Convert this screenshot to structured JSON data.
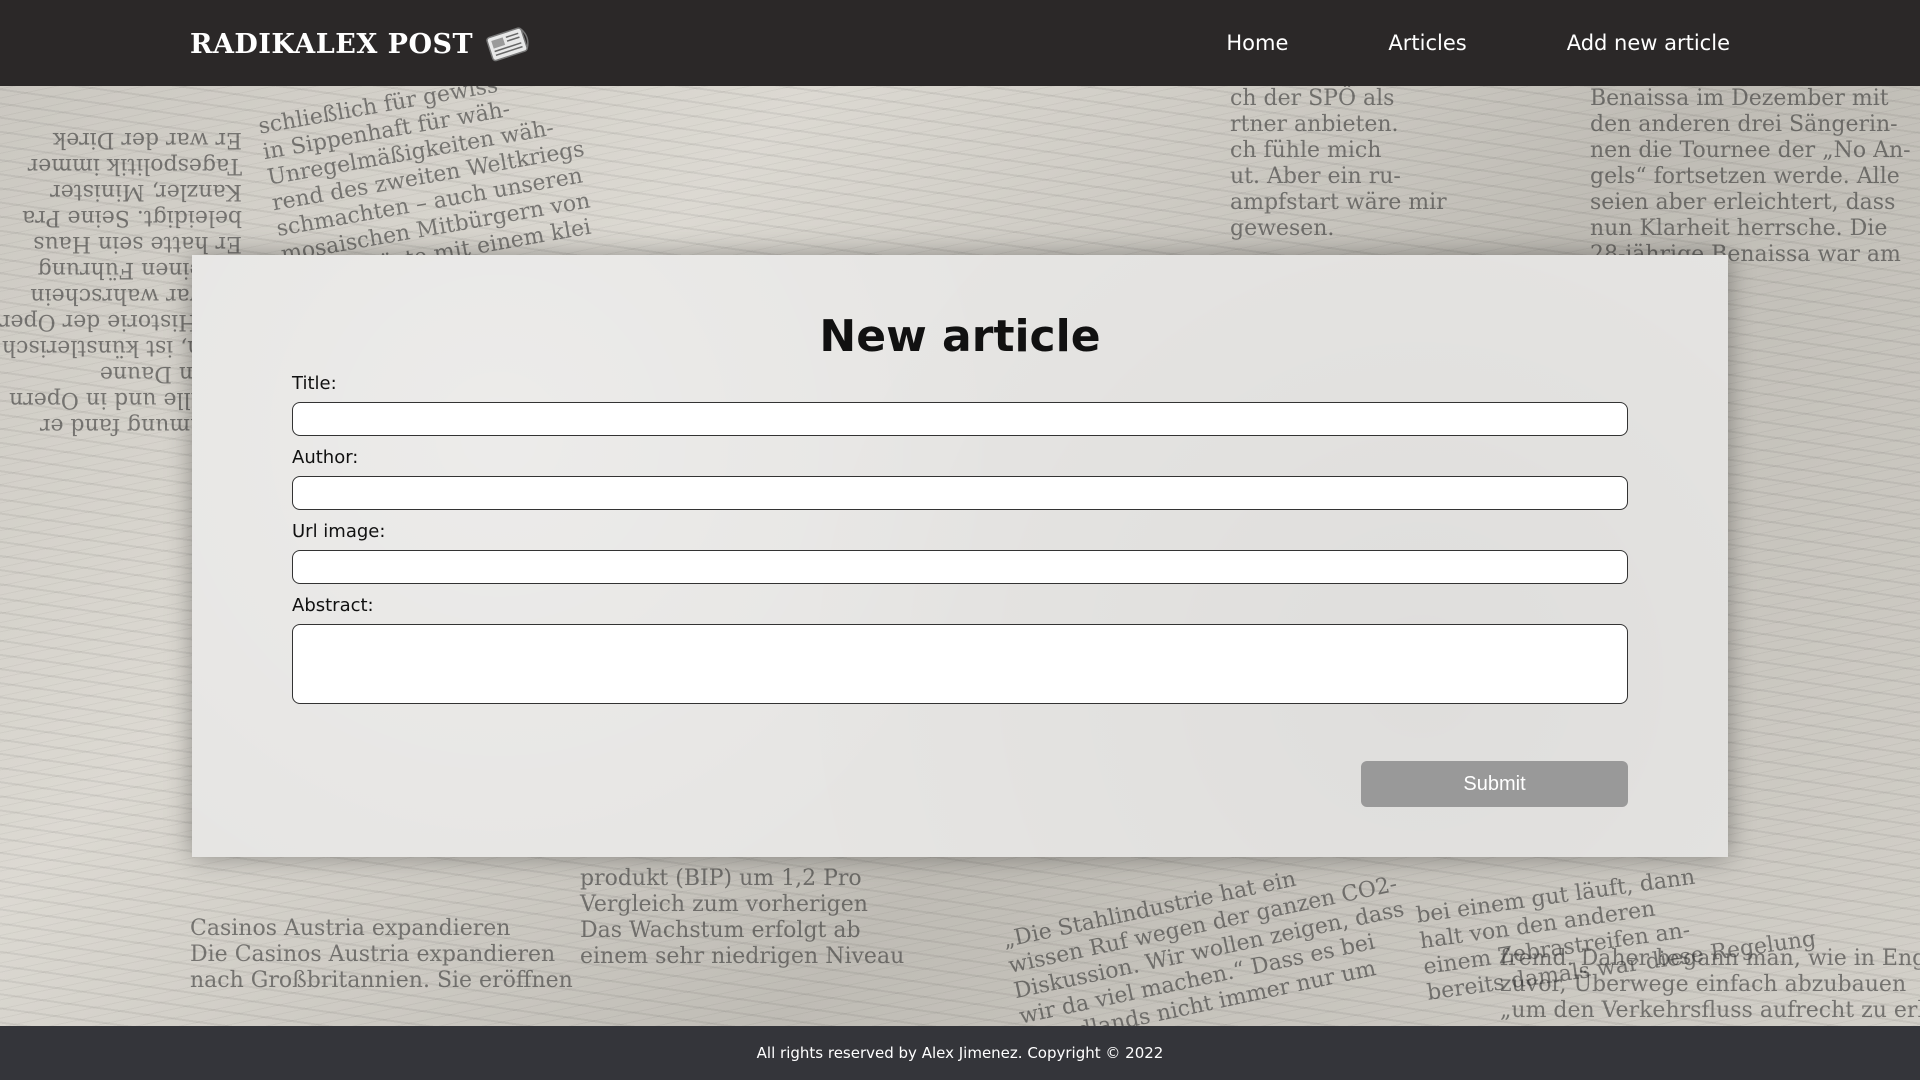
{
  "header": {
    "brand": "RADIKALEX POST",
    "brand_icon": "newspaper-icon",
    "nav": [
      {
        "label": "Home"
      },
      {
        "label": "Articles"
      },
      {
        "label": "Add new article"
      }
    ]
  },
  "form": {
    "title": "New article",
    "fields": {
      "title": {
        "label": "Title:",
        "value": ""
      },
      "author": {
        "label": "Author:",
        "value": ""
      },
      "url_image": {
        "label": "Url image:",
        "value": ""
      },
      "abstract": {
        "label": "Abstract:",
        "value": ""
      }
    },
    "submit_label": "Submit"
  },
  "footer": {
    "text": "All rights reserved by Alex Jimenez.  Copyright © 2022"
  },
  "colors": {
    "navbar": "#2b2828",
    "footer": "#34353a",
    "card": "#e6e5e3",
    "submit": "#999999"
  }
}
